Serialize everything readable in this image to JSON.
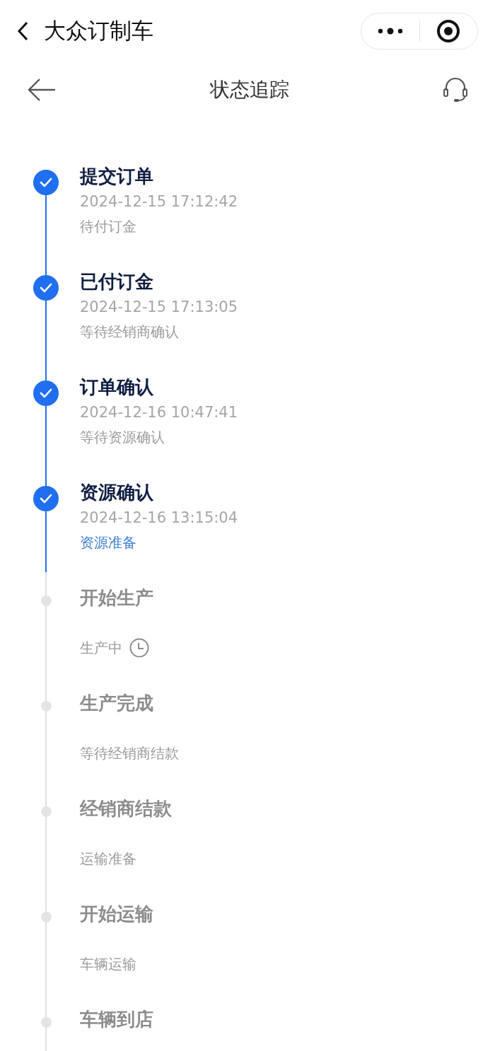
{
  "app_bar": {
    "title": "大众订制车"
  },
  "nav_bar": {
    "title": "状态追踪"
  },
  "steps": [
    {
      "title": "提交订单",
      "time": "2024-12-15 17:12:42",
      "note": "待付订金",
      "kind": "done"
    },
    {
      "title": "已付订金",
      "time": "2024-12-15 17:13:05",
      "note": "等待经销商确认",
      "kind": "done"
    },
    {
      "title": "订单确认",
      "time": "2024-12-16 10:47:41",
      "note": "等待资源确认",
      "kind": "done"
    },
    {
      "title": "资源确认",
      "time": "2024-12-16 13:15:04",
      "note": "资源准备",
      "kind": "current"
    },
    {
      "title": "开始生产",
      "note": "生产中",
      "kind": "waiting"
    },
    {
      "title": "生产完成",
      "note": "等待经销商结款",
      "kind": "pending"
    },
    {
      "title": "经销商结款",
      "note": "运输准备",
      "kind": "pending"
    },
    {
      "title": "开始运输",
      "note": "车辆运输",
      "kind": "pending"
    },
    {
      "title": "车辆到店",
      "kind": "pending"
    }
  ]
}
